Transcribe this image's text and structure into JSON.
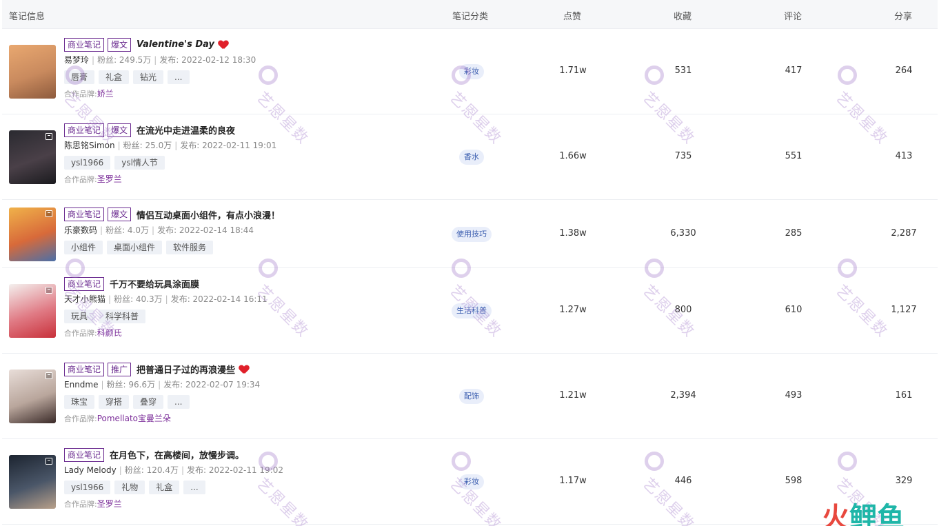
{
  "header": {
    "note_info": "笔记信息",
    "category": "笔记分类",
    "likes": "点赞",
    "favorites": "收藏",
    "comments": "评论",
    "shares": "分享"
  },
  "rows": [
    {
      "tags": [
        "商业笔记",
        "爆文"
      ],
      "title": "Valentine's Day",
      "author": "易梦玲",
      "fans_label": "粉丝: 249.5万",
      "publish_label": "发布: 2022-02-12 18:30",
      "keywords": [
        "唇膏",
        "礼盒",
        "钻光",
        "..."
      ],
      "brand_label": "合作品牌:",
      "brand": "娇兰",
      "category": "彩妆",
      "likes": "1.71w",
      "favorites": "531",
      "comments": "417",
      "shares": "264",
      "thumb_colors": [
        "#e9a870",
        "#c98a5e",
        "#8d5a3c"
      ]
    },
    {
      "tags": [
        "商业笔记",
        "爆文"
      ],
      "title": "在流光中走进温柔的良夜",
      "author": "陈思铭Simon",
      "fans_label": "粉丝: 25.0万",
      "publish_label": "发布: 2022-02-11 19:01",
      "keywords": [
        "ysl1966",
        "ysl情人节"
      ],
      "brand_label": "合作品牌:",
      "brand": "圣罗兰",
      "category": "香水",
      "likes": "1.66w",
      "favorites": "735",
      "comments": "551",
      "shares": "413",
      "thumb_colors": [
        "#2a2a30",
        "#4a4048",
        "#1a1a1e"
      ]
    },
    {
      "tags": [
        "商业笔记",
        "爆文"
      ],
      "title": "情侣互动桌面小组件，有点小浪漫！",
      "author": "乐豪数码",
      "fans_label": "粉丝: 4.0万",
      "publish_label": "发布: 2022-02-14 18:44",
      "keywords": [
        "小组件",
        "桌面小组件",
        "软件服务"
      ],
      "brand_label": "",
      "brand": "",
      "category": "使用技巧",
      "likes": "1.38w",
      "favorites": "6,330",
      "comments": "285",
      "shares": "2,287",
      "thumb_colors": [
        "#f0b24a",
        "#d86a3a",
        "#4b6fa8"
      ]
    },
    {
      "tags": [
        "商业笔记"
      ],
      "title": "千万不要给玩具涂面膜",
      "author": "天才小熊猫",
      "fans_label": "粉丝: 40.3万",
      "publish_label": "发布: 2022-02-14 16:11",
      "keywords": [
        "玩具",
        "科学科普"
      ],
      "brand_label": "合作品牌:",
      "brand": "科颜氏",
      "category": "生活科普",
      "likes": "1.27w",
      "favorites": "800",
      "comments": "610",
      "shares": "1,127",
      "thumb_colors": [
        "#f4f0ee",
        "#e07a84",
        "#c8303a"
      ]
    },
    {
      "tags": [
        "商业笔记",
        "推广"
      ],
      "title": "把普通日子过的再浪漫些",
      "author": "Enndme",
      "fans_label": "粉丝: 96.6万",
      "publish_label": "发布: 2022-02-07 19:34",
      "keywords": [
        "珠宝",
        "穿搭",
        "叠穿",
        "..."
      ],
      "brand_label": "合作品牌:",
      "brand": "Pomellato宝曼兰朵",
      "category": "配饰",
      "likes": "1.21w",
      "favorites": "2,394",
      "comments": "493",
      "shares": "161",
      "thumb_colors": [
        "#e8ddd8",
        "#b9a69c",
        "#3a2a28"
      ]
    },
    {
      "tags": [
        "商业笔记"
      ],
      "title": "在月色下，在高楼间，放慢步调。",
      "author": "Lady Melody",
      "fans_label": "粉丝: 120.4万",
      "publish_label": "发布: 2022-02-11 19:02",
      "keywords": [
        "ysl1966",
        "礼物",
        "礼盒",
        "..."
      ],
      "brand_label": "合作品牌:",
      "brand": "圣罗兰",
      "category": "彩妆",
      "likes": "1.17w",
      "favorites": "446",
      "comments": "598",
      "shares": "329",
      "thumb_colors": [
        "#1c2430",
        "#4a5668",
        "#b8a08a"
      ]
    }
  ],
  "watermark": "艺恩星数",
  "logo": {
    "part1": "火",
    "part2": "鲤鱼"
  }
}
